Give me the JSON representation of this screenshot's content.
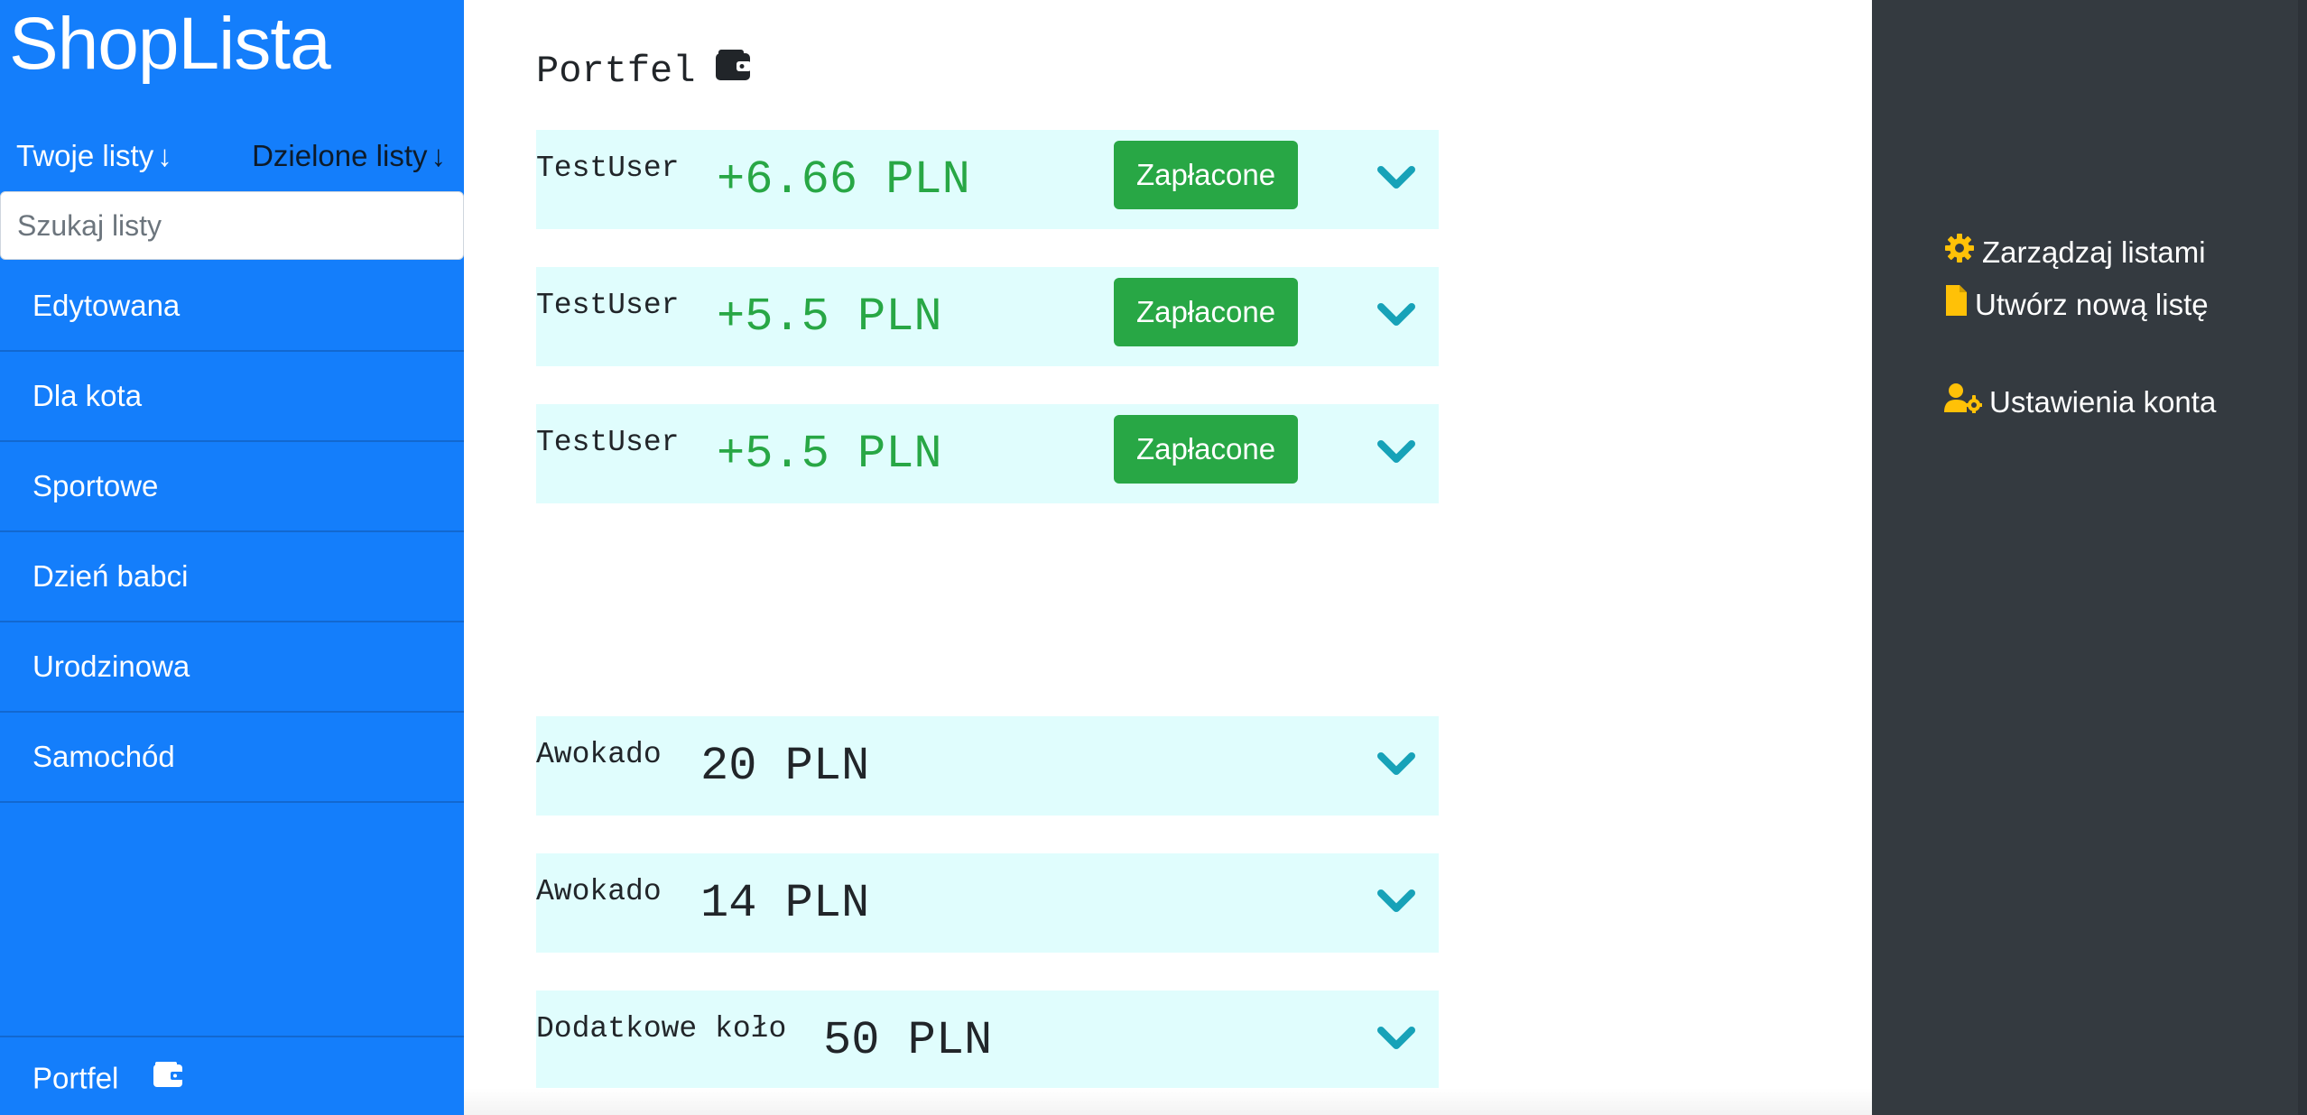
{
  "sidebar": {
    "brand": "ShopLista",
    "own_lists_label": "Twoje listy",
    "shared_lists_label": "Dzielone listy",
    "arrow": "↓",
    "search_placeholder": "Szukaj listy",
    "items": [
      {
        "label": "Edytowana"
      },
      {
        "label": "Dla kota"
      },
      {
        "label": "Sportowe"
      },
      {
        "label": "Dzień babci"
      },
      {
        "label": "Urodzinowa"
      },
      {
        "label": "Samochód"
      }
    ],
    "wallet_label": "Portfel",
    "wallet_icon": "wallet-icon"
  },
  "main": {
    "title": "Portfel",
    "title_icon": "wallet-icon",
    "payments": [
      {
        "user": "TestUser",
        "amount": "+6.66 PLN",
        "button": "Zapłacone"
      },
      {
        "user": "TestUser",
        "amount": "+5.5 PLN",
        "button": "Zapłacone"
      },
      {
        "user": "TestUser",
        "amount": "+5.5 PLN",
        "button": "Zapłacone"
      }
    ],
    "expenses": [
      {
        "item": "Awokado",
        "amount": "20 PLN"
      },
      {
        "item": "Awokado",
        "amount": "14 PLN"
      },
      {
        "item": "Dodatkowe koło",
        "amount": "50 PLN"
      }
    ]
  },
  "right_panel": {
    "manage_lists": "Zarządzaj listami",
    "new_list": "Utwórz nową listę",
    "account_settings": "Ustawienia konta"
  },
  "colors": {
    "sidebar_bg": "#147efb",
    "right_panel_bg": "#343a40",
    "card_bg": "#e0fdfd",
    "positive": "#28a745",
    "chevron": "#17a2b8",
    "icon_accent": "#ffc107"
  }
}
